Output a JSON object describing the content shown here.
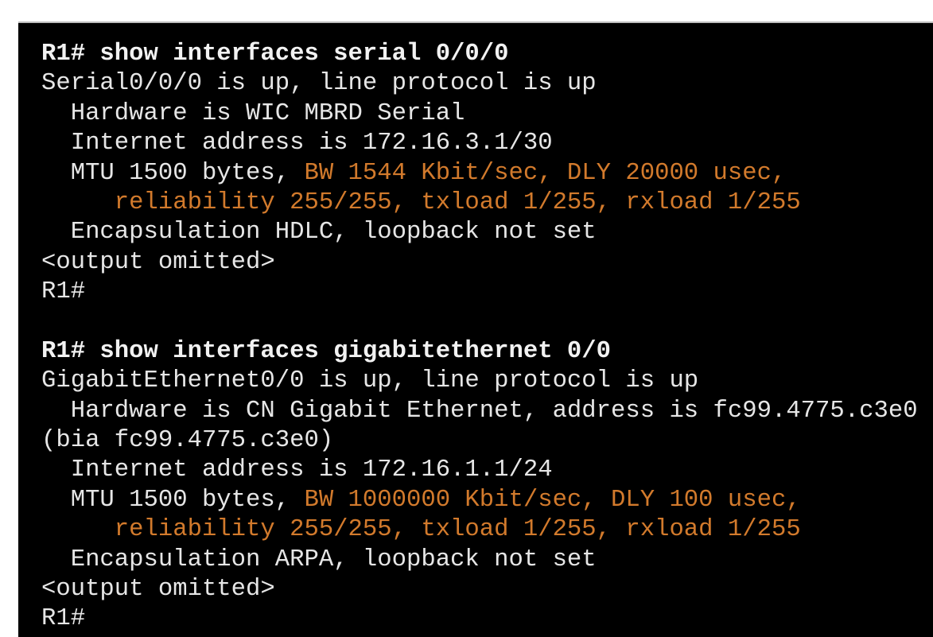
{
  "terminal": {
    "colors": {
      "background": "#000000",
      "text": "#e6e6e6",
      "highlight": "#d27a2c"
    },
    "lines": [
      [
        {
          "t": "R1# show interfaces serial 0/0/0",
          "s": "cmd"
        }
      ],
      [
        {
          "t": "Serial0/0/0 is up, line protocol is up",
          "s": "out"
        }
      ],
      [
        {
          "t": "  Hardware is WIC MBRD Serial",
          "s": "out"
        }
      ],
      [
        {
          "t": "  Internet address is 172.16.3.1/30",
          "s": "out"
        }
      ],
      [
        {
          "t": "  MTU 1500 bytes, ",
          "s": "out"
        },
        {
          "t": "BW 1544 Kbit/sec, DLY 20000 usec,",
          "s": "hl"
        }
      ],
      [
        {
          "t": "     reliability 255/255, txload 1/255, rxload 1/255",
          "s": "hl"
        }
      ],
      [
        {
          "t": "  Encapsulation HDLC, loopback not set",
          "s": "out"
        }
      ],
      [
        {
          "t": "<output omitted>",
          "s": "out"
        }
      ],
      [
        {
          "t": "R1#",
          "s": "out"
        }
      ],
      [
        {
          "t": "",
          "s": "out"
        }
      ],
      [
        {
          "t": "R1# show interfaces gigabitethernet 0/0",
          "s": "cmd"
        }
      ],
      [
        {
          "t": "GigabitEthernet0/0 is up, line protocol is up",
          "s": "out"
        }
      ],
      [
        {
          "t": "  Hardware is CN Gigabit Ethernet, address is fc99.4775.c3e0",
          "s": "out"
        }
      ],
      [
        {
          "t": "(bia fc99.4775.c3e0)",
          "s": "out"
        }
      ],
      [
        {
          "t": "  Internet address is 172.16.1.1/24",
          "s": "out"
        }
      ],
      [
        {
          "t": "  MTU 1500 bytes, ",
          "s": "out"
        },
        {
          "t": "BW 1000000 Kbit/sec, DLY 100 usec,",
          "s": "hl"
        }
      ],
      [
        {
          "t": "     reliability 255/255, txload 1/255, rxload 1/255",
          "s": "hl"
        }
      ],
      [
        {
          "t": "  Encapsulation ARPA, loopback not set",
          "s": "out"
        }
      ],
      [
        {
          "t": "<output omitted>",
          "s": "out"
        }
      ],
      [
        {
          "t": "R1#",
          "s": "out"
        }
      ]
    ]
  }
}
